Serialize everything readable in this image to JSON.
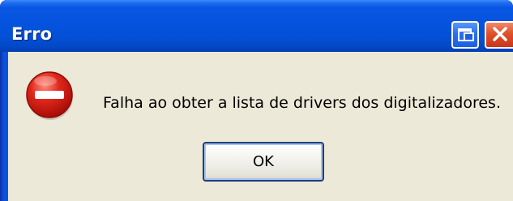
{
  "window": {
    "title": "Erro",
    "controls": {
      "restore_icon": "restore-window-icon",
      "close_icon": "close-x-icon"
    }
  },
  "dialog": {
    "icon": "error-stop-icon",
    "message": "Falha ao obter a lista de drivers dos digitalizadores.",
    "ok_label": "OK"
  },
  "colors": {
    "titlebar": "#0553de",
    "dialog_background": "#ece9d8",
    "close_button": "#e0502a",
    "error_icon": "#d8231a"
  }
}
